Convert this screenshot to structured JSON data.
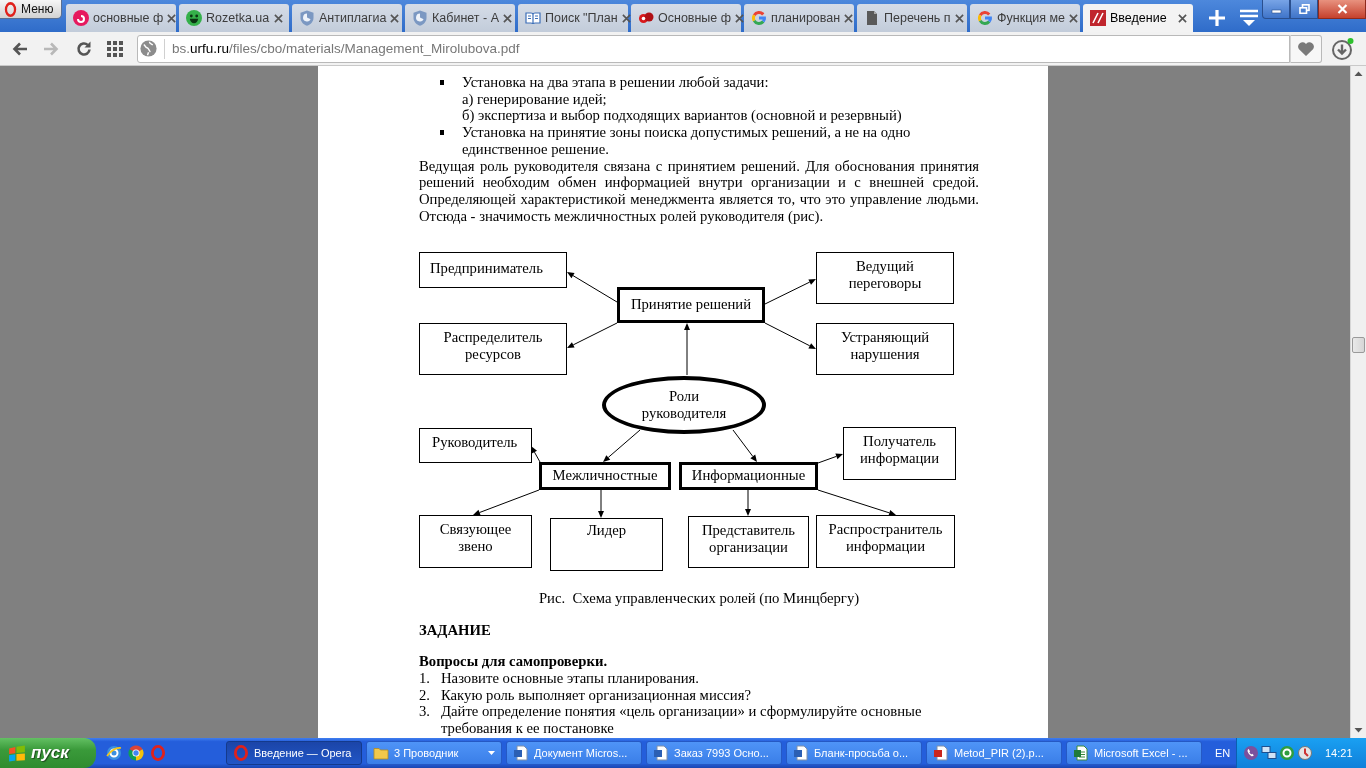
{
  "browser": {
    "menu_button": "Меню",
    "tabs": [
      {
        "title": "основные ф",
        "selected": false
      },
      {
        "title": "Rozetka.ua",
        "selected": false
      },
      {
        "title": "Антиплагиа",
        "selected": false
      },
      {
        "title": "Кабинет - А",
        "selected": false
      },
      {
        "title": "Поиск \"План",
        "selected": false
      },
      {
        "title": "Основные ф",
        "selected": false
      },
      {
        "title": "планирован",
        "selected": false
      },
      {
        "title": "Перечень п",
        "selected": false
      },
      {
        "title": "Функция ме",
        "selected": false
      },
      {
        "title": "Введение",
        "selected": true
      }
    ],
    "navigation": {
      "forward_disabled": true
    },
    "address": {
      "subdomain": "bs.",
      "domain": "urfu.ru",
      "path": "/files/cbo/materials/Management_Mirolubova.pdf"
    }
  },
  "document": {
    "bullets": [
      {
        "text": "Установка на два этапа в решении любой задачи:",
        "sub_items": [
          "а) генерирование идей;",
          "б) экспертиза и выбор подходящих вариантов (основной и резервный)"
        ]
      },
      {
        "text": "Установка на принятие зоны поиска допустимых решений, а не на одно единственное решение."
      }
    ],
    "paragraph": "Ведущая роль руководителя связана с принятием решений. Для обоснования принятия решений необходим обмен информацией внутри организации и с внешней средой. Определяющей характеристикой менеджмента является то, что это управление людьми. Отсюда - значимость межличностных ролей руководителя (рис).",
    "diagram": {
      "label": "Роли руководителя",
      "kind": "ellipse",
      "children": [
        {
          "label": "Принятие решений",
          "kind": "category",
          "children": [
            {
              "label": "Предприниматель",
              "kind": "role"
            },
            {
              "label": "Ведущий переговоры",
              "kind": "role"
            },
            {
              "label": "Распределитель ресурсов",
              "kind": "role"
            },
            {
              "label": "Устраняющий нарушения",
              "kind": "role"
            }
          ]
        },
        {
          "label": "Межличностные",
          "kind": "category",
          "children": [
            {
              "label": "Руководитель",
              "kind": "role"
            },
            {
              "label": "Связующее звено",
              "kind": "role"
            },
            {
              "label": "Лидер",
              "kind": "role"
            }
          ]
        },
        {
          "label": "Информационные",
          "kind": "category",
          "children": [
            {
              "label": "Получатель информации",
              "kind": "role"
            },
            {
              "label": "Представитель организации",
              "kind": "role"
            },
            {
              "label": "Распространитель информации",
              "kind": "role"
            }
          ]
        }
      ]
    },
    "caption": "Рис.  Схема управленческих ролей (по Минцбергу)",
    "task_heading": "ЗАДАНИЕ",
    "questions_title": "Вопросы для самопроверки.",
    "questions": [
      {
        "number": "1.",
        "text": "Назовите основные этапы планирования."
      },
      {
        "number": "2.",
        "text": "Какую роль выполняет организационная миссия?"
      },
      {
        "number": "3.",
        "text": "Дайте определение понятия «цель организации» и сформулируйте основные требования к ее постановке"
      }
    ]
  },
  "taskbar": {
    "start": "пуск",
    "tasks": [
      {
        "title": "Введение — Opera",
        "selected": true,
        "grouped": false
      },
      {
        "title": "3 Проводник",
        "selected": false,
        "grouped": true
      },
      {
        "title": "Документ Micros...",
        "selected": false,
        "grouped": false
      },
      {
        "title": "Заказ 7993 Осно...",
        "selected": false,
        "grouped": false
      },
      {
        "title": "Бланк-просьба о...",
        "selected": false,
        "grouped": false
      },
      {
        "title": "Metod_PIR (2).p...",
        "selected": false,
        "grouped": false
      },
      {
        "title": "Microsoft Excel - ...",
        "selected": false,
        "grouped": false
      }
    ],
    "language": "EN",
    "clock": "14:21"
  }
}
